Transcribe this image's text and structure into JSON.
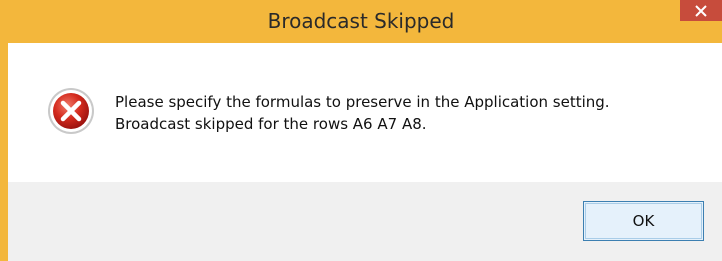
{
  "dialog": {
    "title": "Broadcast Skipped",
    "close_icon": "close-icon",
    "error_icon": "error-icon",
    "message_line1": "Please specify the formulas to preserve in the Application setting.",
    "message_line2": "Broadcast skipped for the rows  A6 A7 A8.",
    "ok_label": "OK"
  },
  "colors": {
    "titlebar": "#f3b73c",
    "close_button": "#c74c3c",
    "content_bg": "#ffffff",
    "footer_bg": "#f0f0f0",
    "button_border": "#3c7fb1"
  }
}
